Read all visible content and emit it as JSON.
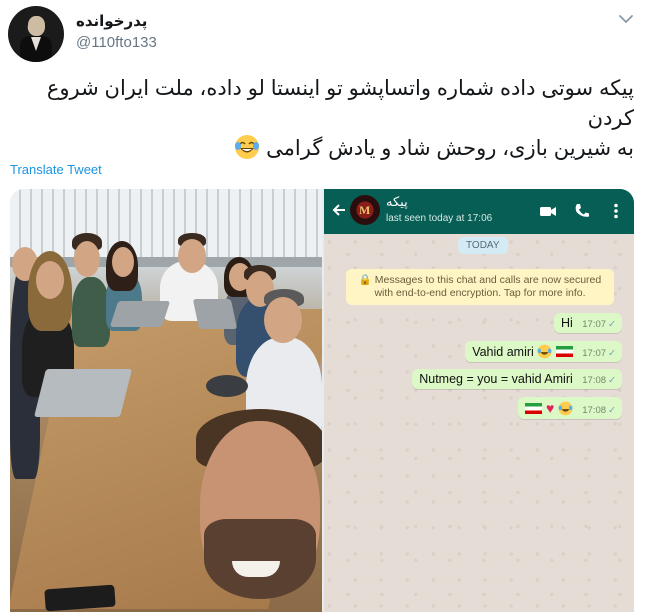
{
  "tweet": {
    "display_name": "پدرخوانده",
    "handle": "@110fto133",
    "text_line1": "پیکه سوتی داده شماره واتساپشو تو اینستا لو داده، ملت ایران شروع کردن",
    "text_line2": "به شیرین بازی، روحش شاد و یادش گرامی",
    "translate_label": "Translate Tweet",
    "icons": {
      "menu": "chevron-down-icon",
      "emoji": "face-with-tears-of-joy"
    }
  },
  "whatsapp": {
    "contact_name": "پیکه",
    "avatar_letter": "M",
    "last_seen": "last seen today at 17:06",
    "date_chip": "TODAY",
    "encryption_notice": "🔒 Messages to this chat and calls are now secured with end-to-end encryption. Tap for more info.",
    "messages": [
      {
        "text": "Hi",
        "time": "17:07"
      },
      {
        "text": "Vahid amiri",
        "time": "17:07"
      },
      {
        "text": "Nutmeg = you = vahid Amiri",
        "time": "17:08"
      },
      {
        "text": "",
        "time": "17:08"
      }
    ],
    "header_color": "#075e54",
    "bubble_color": "#dcf8c6"
  },
  "colors": {
    "link": "#1b95e0",
    "muted": "#657786"
  }
}
